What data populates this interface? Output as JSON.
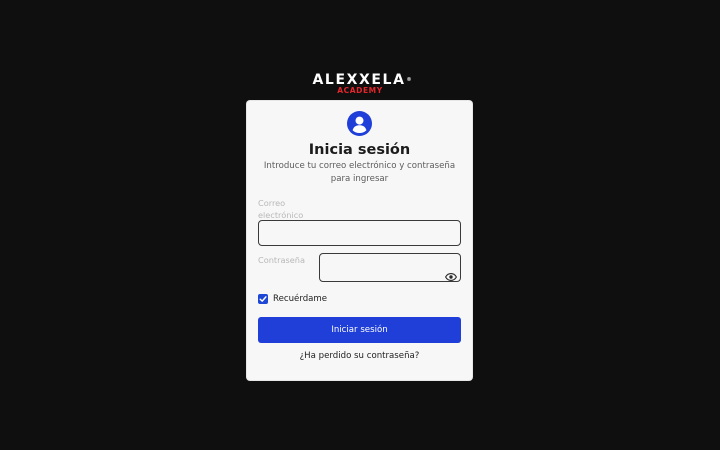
{
  "brand": {
    "name": "ALEXXELA",
    "registered_mark": "®",
    "subname": "ACADEMY",
    "sub_color": "#e3262b"
  },
  "login": {
    "icon": "user-circle-icon",
    "title": "Inicia sesión",
    "subtitle": "Introduce tu correo electrónico y contraseña para ingresar",
    "email_label": "Correo electrónico",
    "email_value": "",
    "password_label": "Contraseña",
    "password_value": "",
    "password_toggle_icon": "eye-icon",
    "remember_label": "Recuérdame",
    "remember_checked": true,
    "submit_label": "Iniciar sesión",
    "forgot_label": "¿Ha perdido su contraseña?"
  },
  "colors": {
    "background": "#0f0f0f",
    "card": "#f7f7f7",
    "accent": "#1f3fd8"
  }
}
